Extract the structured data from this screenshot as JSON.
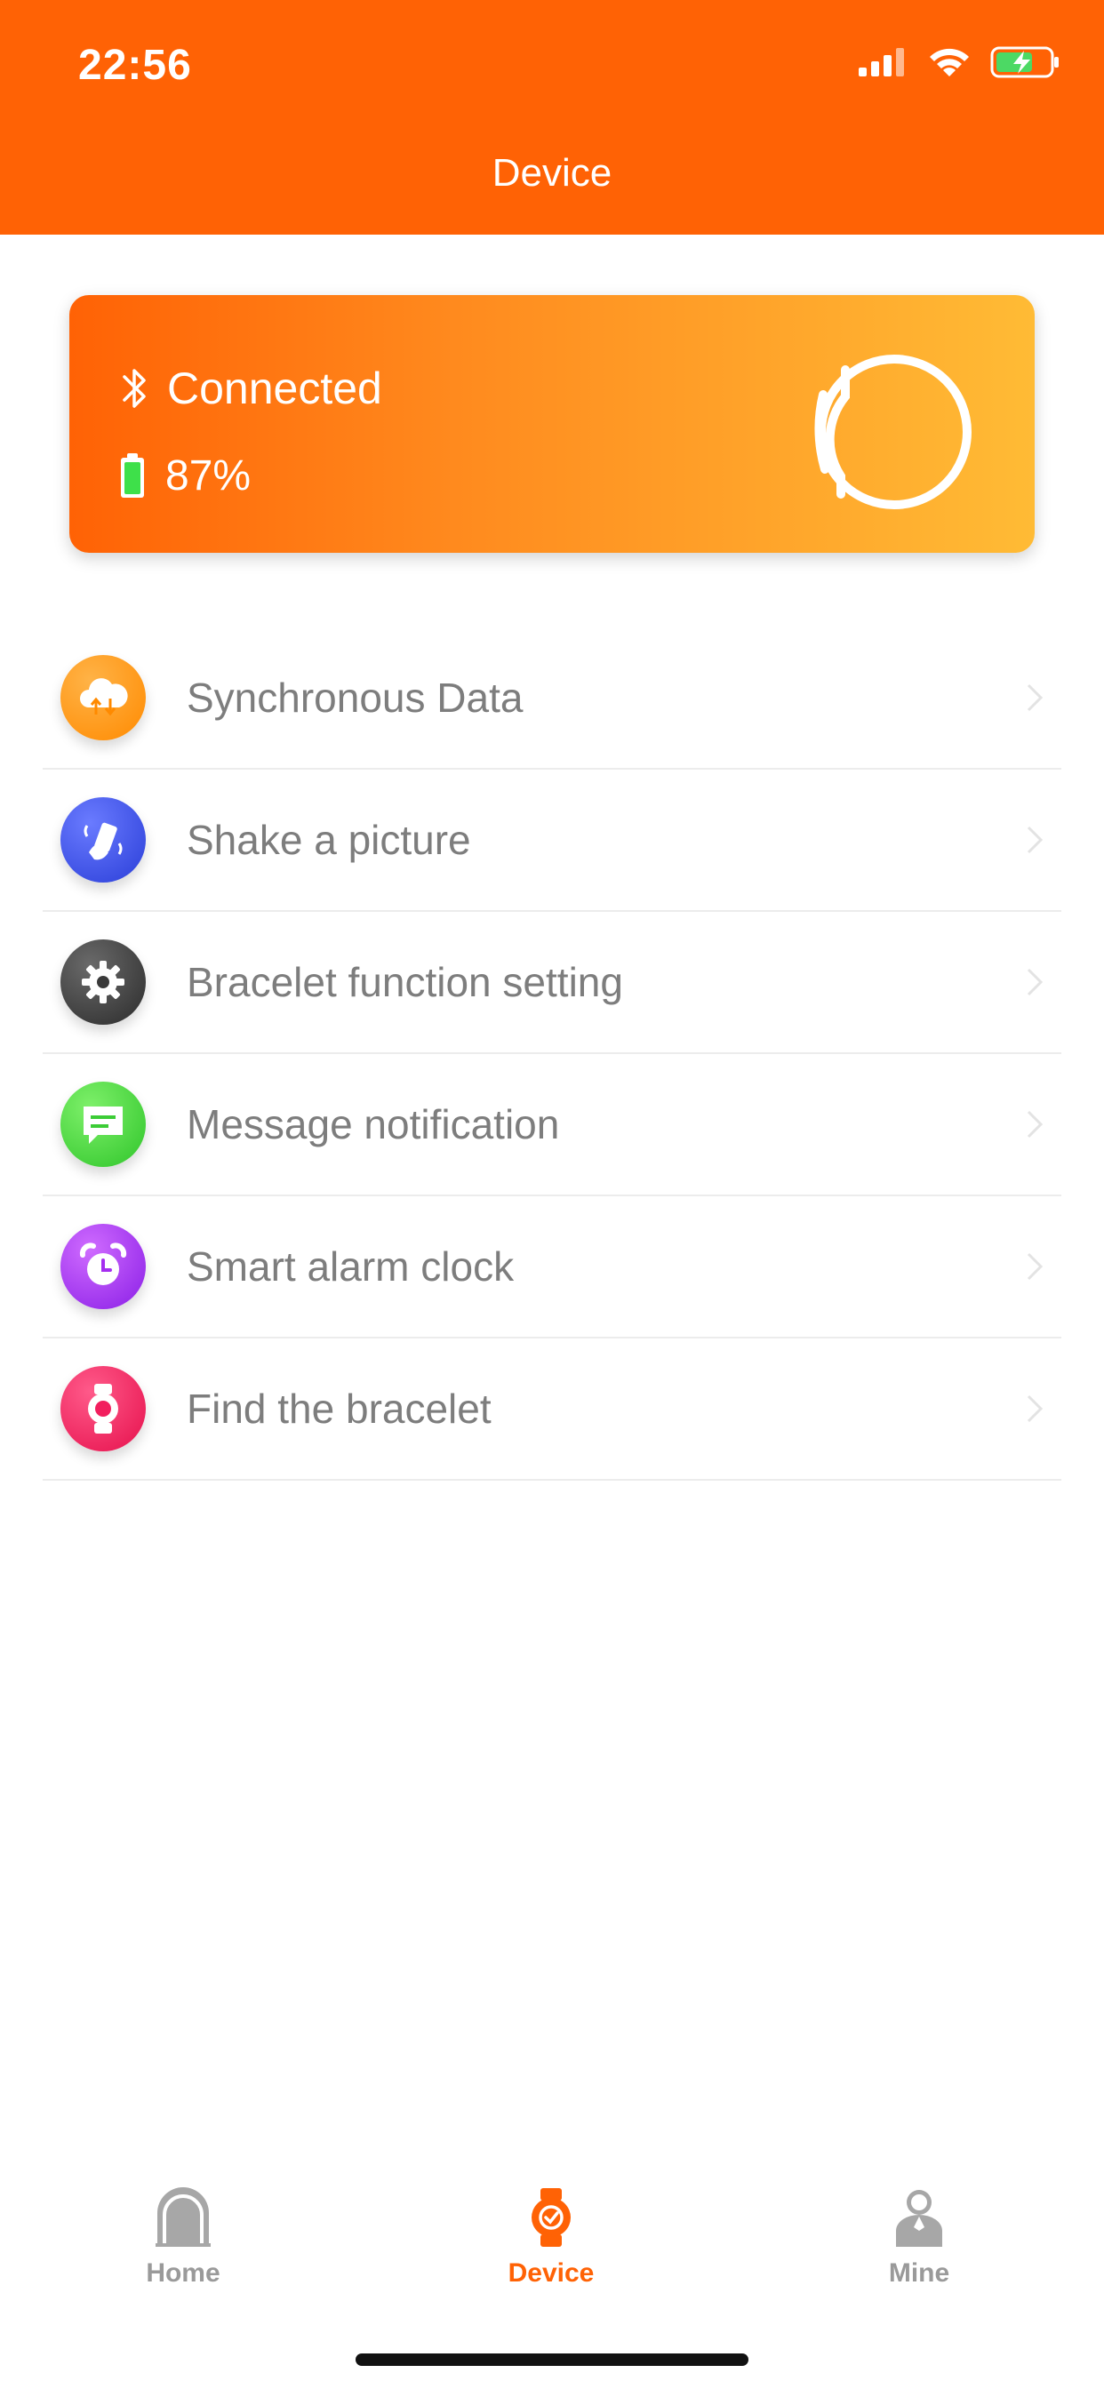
{
  "status_bar": {
    "time": "22:56",
    "icons": [
      "signal-icon",
      "wifi-icon",
      "battery-charging-icon"
    ]
  },
  "header": {
    "title": "Device",
    "background": "#ff6205"
  },
  "device_card": {
    "connection_icon": "bluetooth-icon",
    "connection_status": "Connected",
    "battery_icon": "battery-icon",
    "battery_level": "87%",
    "gradient": [
      "#ff6205",
      "#ffbb35"
    ]
  },
  "menu": {
    "items": [
      {
        "label": "Synchronous Data",
        "icon": "cloud-sync-icon",
        "color": "#ff9d0a"
      },
      {
        "label": "Shake a picture",
        "icon": "shake-phone-icon",
        "color": "#3b4fe0"
      },
      {
        "label": "Bracelet function setting",
        "icon": "gear-icon",
        "color": "#3a3a3a"
      },
      {
        "label": "Message notification",
        "icon": "message-icon",
        "color": "#44d23f"
      },
      {
        "label": "Smart alarm clock",
        "icon": "alarm-clock-icon",
        "color": "#a52ef0"
      },
      {
        "label": "Find the bracelet",
        "icon": "watch-icon",
        "color": "#f21e5e"
      }
    ]
  },
  "tabbar": {
    "tabs": [
      {
        "label": "Home",
        "icon": "home-icon",
        "active": false
      },
      {
        "label": "Device",
        "icon": "watch-tab-icon",
        "active": true
      },
      {
        "label": "Mine",
        "icon": "person-icon",
        "active": false
      }
    ],
    "active_color": "#ff6205",
    "inactive_color": "#9a9a9a"
  }
}
